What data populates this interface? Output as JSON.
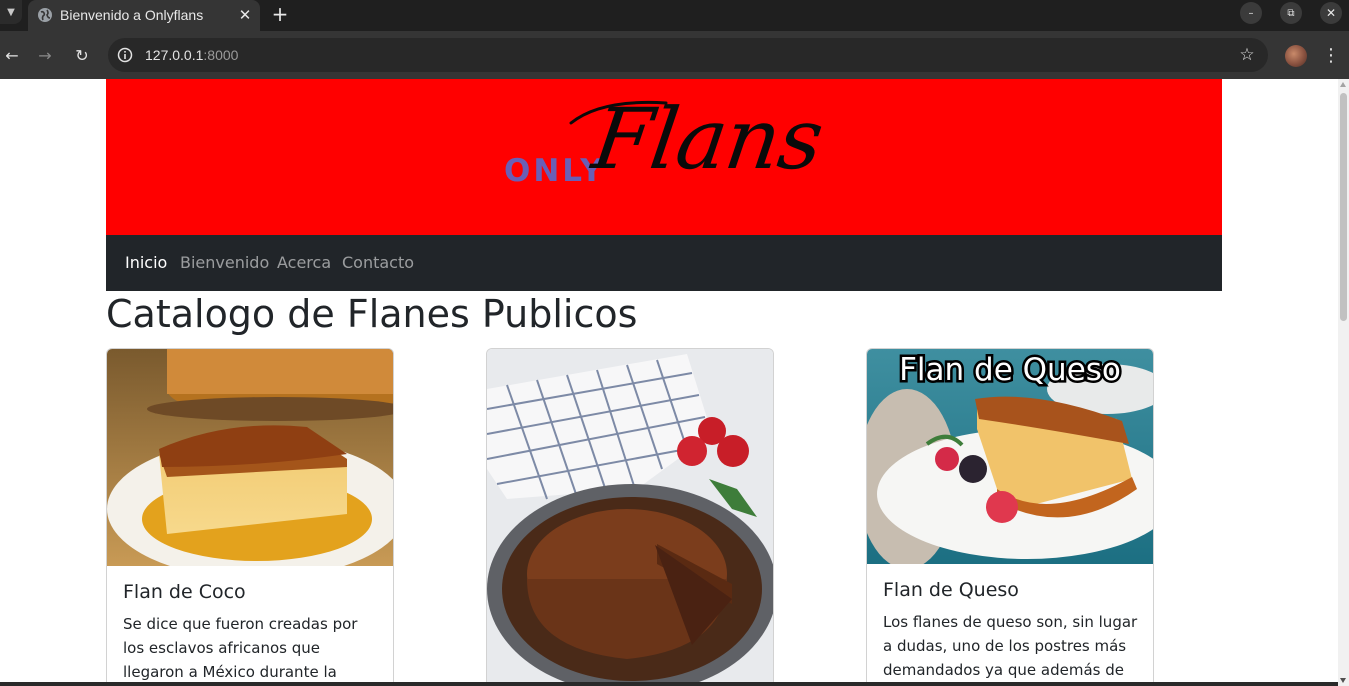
{
  "browser": {
    "tab_title": "Bienvenido a Onlyflans",
    "url_host": "127.0.0.1",
    "url_port": ":8000"
  },
  "header": {
    "logo_prefix": "ONLY",
    "logo_main": "Flans"
  },
  "nav": {
    "items": [
      {
        "label": "Inicio",
        "active": true
      },
      {
        "label": "Bienvenido",
        "active": false
      },
      {
        "label": "Acerca",
        "active": false
      },
      {
        "label": "Contacto",
        "active": false
      }
    ]
  },
  "main": {
    "title": "Catalogo de Flanes Publicos",
    "cards": [
      {
        "title": "Flan de Coco",
        "text": "Se dice que fueron creadas por los esclavos africanos que llegaron a México durante la época colonial.",
        "image_caption": ""
      },
      {
        "title": "",
        "text": "",
        "image_caption": ""
      },
      {
        "title": "Flan de Queso",
        "text": "Los flanes de queso son, sin lugar a dudas, uno de los postres más demandados ya que además de ser",
        "image_caption": "Flan de Queso"
      }
    ]
  },
  "colors": {
    "banner": "#ff0000",
    "navbar": "#212529",
    "logo_prefix": "#6a5fb6"
  }
}
